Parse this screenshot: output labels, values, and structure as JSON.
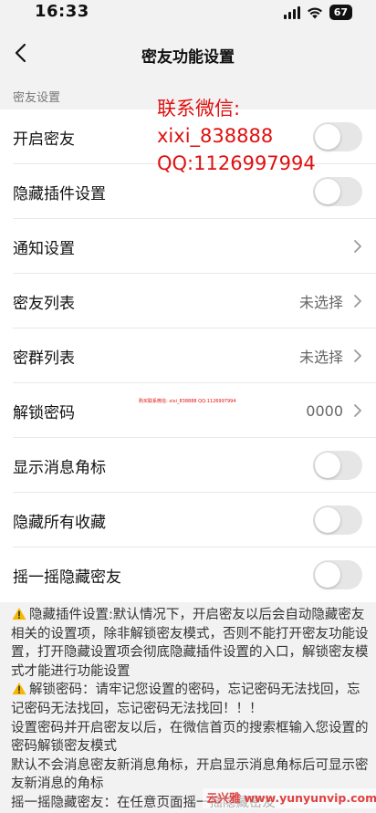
{
  "status_bar": {
    "time": "16:33",
    "battery": "67"
  },
  "nav": {
    "title": "密友功能设置"
  },
  "section_label": "密友设置",
  "rows": [
    {
      "label": "开启密友",
      "type": "toggle",
      "on": false
    },
    {
      "label": "隐藏插件设置",
      "type": "toggle",
      "on": false
    },
    {
      "label": "通知设置",
      "type": "link",
      "value": ""
    },
    {
      "label": "密友列表",
      "type": "link",
      "value": "未选择"
    },
    {
      "label": "密群列表",
      "type": "link",
      "value": "未选择"
    },
    {
      "label": "解锁密码",
      "type": "link",
      "value": "0000"
    },
    {
      "label": "显示消息角标",
      "type": "toggle",
      "on": false
    },
    {
      "label": "隐藏所有收藏",
      "type": "toggle",
      "on": false
    },
    {
      "label": "摇一摇隐藏密友",
      "type": "toggle",
      "on": false
    }
  ],
  "notes": [
    "隐藏插件设置:默认情况下，开启密友以后会自动隐藏密友相关的设置项，除非解锁密友模式，否则不能打开密友功能设置，打开隐藏设置项会彻底隐藏插件设置的入口，解锁密友模式才能进行功能设置",
    "解锁密码：请牢记您设置的密码，忘记密码无法找回，忘记密码无法找回，忘记密码无法找回！！！",
    "设置密码并开启密友以后，在微信首页的搜索框输入您设置的密码解锁密友模式",
    "默认不会消息密友新消息角标，开启显示消息角标后可显示密友新消息的角标",
    "摇一摇隐藏密友：在任意页面摇一摇隐藏密友"
  ],
  "overlay": {
    "line1": "联系微信:",
    "line2": "xixi_838888",
    "line3": "QQ:1126997994"
  },
  "tiny_watermark": "购买联系微信: xixi_838888    QQ:1126997994",
  "corner_watermark": {
    "prefix": "云兴雅",
    "site": "www.yunyunvip.com"
  }
}
